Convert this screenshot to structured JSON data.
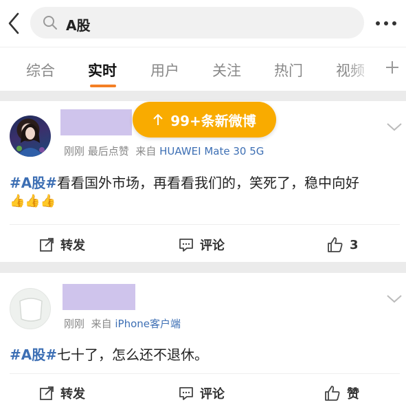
{
  "search": {
    "query": "A股"
  },
  "tabs": [
    {
      "label": "综合"
    },
    {
      "label": "实时"
    },
    {
      "label": "用户"
    },
    {
      "label": "关注"
    },
    {
      "label": "热门"
    },
    {
      "label": "视频"
    }
  ],
  "new_posts_pill": {
    "label": "99+条新微博"
  },
  "posts": [
    {
      "meta_time": "刚刚",
      "meta_extra": "最后点赞",
      "meta_from": "来自",
      "device": "HUAWEI Mate 30 5G",
      "hashtag": "#A股#",
      "text": "看看国外市场，再看看我们的，笑死了，稳中向好",
      "emojis": "👍👍👍",
      "actions": {
        "repost": "转发",
        "comment": "评论",
        "like": "3"
      }
    },
    {
      "meta_time": "刚刚",
      "meta_from": "来自",
      "device": "iPhone客户端",
      "hashtag": "#A股#",
      "text": "七十了，怎么还不退休。",
      "actions": {
        "repost": "转发",
        "comment": "评论",
        "like": "赞"
      }
    }
  ],
  "colors": {
    "accent": "#f47f25",
    "pill": "#f9ab00",
    "link": "#3d6fb4",
    "name_redaction": "#cfc4ec"
  }
}
